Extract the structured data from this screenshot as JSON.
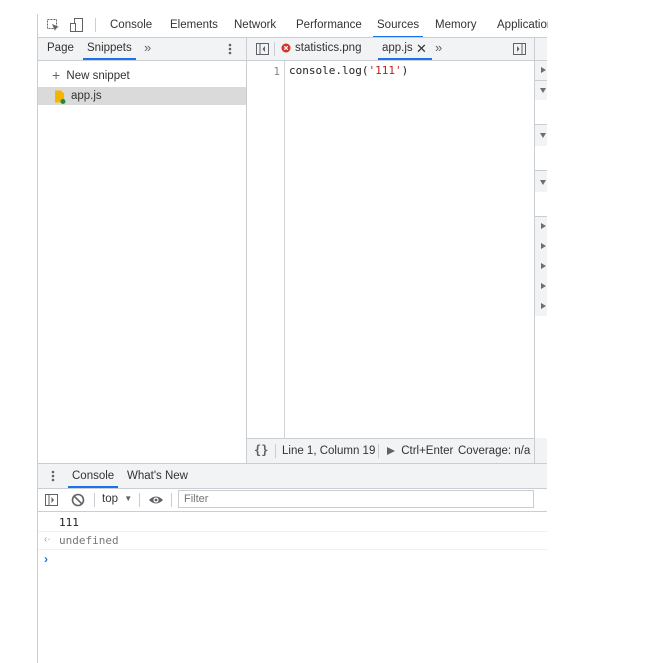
{
  "main_tabs": [
    {
      "label": "Console"
    },
    {
      "label": "Elements"
    },
    {
      "label": "Network"
    },
    {
      "label": "Performance"
    },
    {
      "label": "Sources",
      "active": true
    },
    {
      "label": "Memory"
    },
    {
      "label": "Application"
    }
  ],
  "navigator": {
    "tabs": [
      {
        "label": "Page"
      },
      {
        "label": "Snippets",
        "active": true
      }
    ],
    "new_snippet_label": "New snippet",
    "files": [
      {
        "label": "app.js",
        "selected": true
      }
    ]
  },
  "editor": {
    "tabs": [
      {
        "label": "statistics.png",
        "error": true
      },
      {
        "label": "app.js",
        "active": true
      }
    ],
    "line_number": "1",
    "code_func": "console.log(",
    "code_string": "'111'",
    "code_close": ")"
  },
  "status_bar": {
    "position": "Line 1, Column 19",
    "run_shortcut": "Ctrl+Enter",
    "coverage": "Coverage: n/a"
  },
  "drawer": {
    "tabs": [
      {
        "label": "Console",
        "active": true
      },
      {
        "label": "What's New"
      }
    ],
    "context": "top",
    "filter_placeholder": "Filter"
  },
  "console_output": {
    "log": "111",
    "result": "undefined"
  },
  "colors": {
    "accent": "#1a73e8",
    "string": "#c41a16",
    "error": "#d93025"
  }
}
